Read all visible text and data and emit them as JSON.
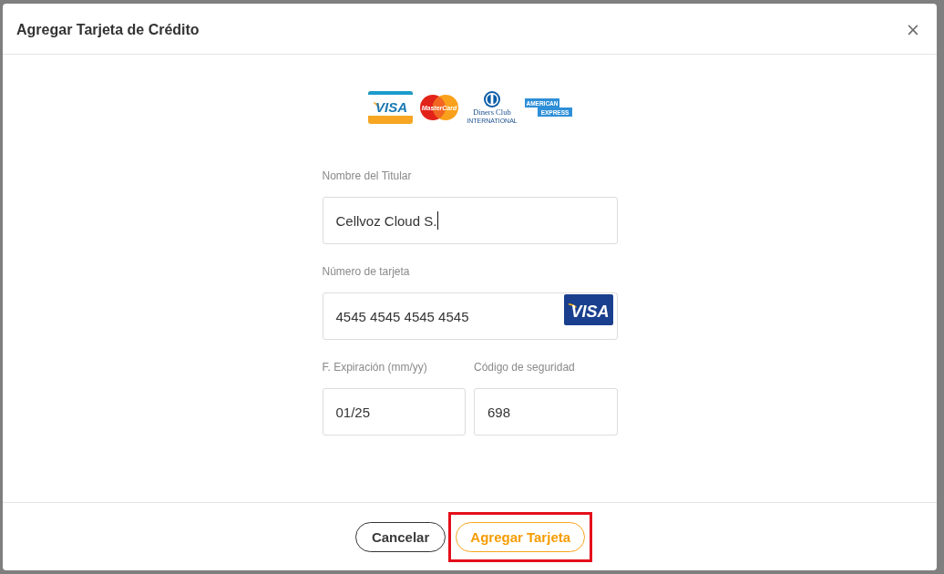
{
  "dialog": {
    "title": "Agregar Tarjeta de Crédito",
    "close": "×"
  },
  "card_brands": [
    {
      "kind": "visa",
      "lines": [
        "VISA"
      ]
    },
    {
      "kind": "mastercard",
      "lines": [
        "MasterCard"
      ]
    },
    {
      "kind": "diners",
      "lines": [
        "Diners Club",
        "INTERNATIONAL"
      ]
    },
    {
      "kind": "amex",
      "lines": [
        "AMERICAN",
        "EXPRESS"
      ]
    }
  ],
  "form": {
    "rows": [
      [
        {
          "label": "Nombre del Titular",
          "value": "Cellvoz Cloud S.",
          "focused": true
        }
      ],
      [
        {
          "label": "Número de tarjeta",
          "value": "4545 4545 4545 4545",
          "focused": false,
          "brand": {
            "kind": "visa",
            "lines": [
              "VISA"
            ]
          }
        }
      ],
      [
        {
          "label": "F. Expiración (mm/yy)",
          "value": "01/25",
          "focused": false
        },
        {
          "label": "Código de seguridad",
          "value": "698",
          "focused": false
        }
      ]
    ]
  },
  "buttons": [
    {
      "label": "Cancelar",
      "kind": "secondary",
      "highlighted": false
    },
    {
      "label": "Agregar Tarjeta",
      "kind": "primary",
      "highlighted": true
    }
  ]
}
